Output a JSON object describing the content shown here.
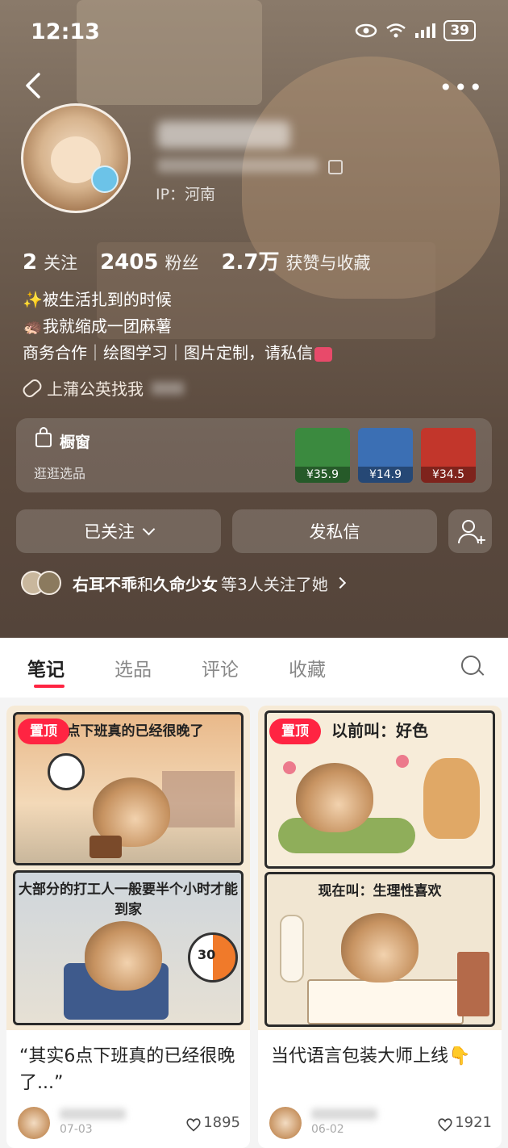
{
  "status_bar": {
    "time": "12:13",
    "battery": "39"
  },
  "profile": {
    "ip_location": "IP：河南",
    "stats": [
      {
        "value": "2",
        "label": "关注"
      },
      {
        "value": "2405",
        "label": "粉丝"
      },
      {
        "value": "2.7万",
        "label": "获赞与收藏"
      }
    ],
    "bio_lines": [
      "✨被生活扎到的时候",
      "🦔我就缩成一团麻薯",
      "商务合作｜绘图学习｜图片定制，请私信"
    ],
    "link_text": "上蒲公英找我"
  },
  "shop": {
    "title": "橱窗",
    "subtitle": "逛逛选品",
    "products": [
      {
        "price": "¥35.9",
        "color": "#3b8a3f"
      },
      {
        "price": "¥14.9",
        "color": "#3b6fb4"
      },
      {
        "price": "¥34.5",
        "color": "#c2362b"
      }
    ]
  },
  "actions": {
    "follow_label": "已关注",
    "message_label": "发私信"
  },
  "mutual": {
    "name1": "右耳不乖",
    "joiner": "和",
    "name2": "久命少女",
    "suffix": "等3人关注了她"
  },
  "tabs": [
    {
      "label": "笔记",
      "active": true
    },
    {
      "label": "选品",
      "active": false
    },
    {
      "label": "评论",
      "active": false
    },
    {
      "label": "收藏",
      "active": false
    }
  ],
  "notes": [
    {
      "pinned_label": "置顶",
      "panel1_caption": "六点下班真的已经很晚了",
      "panel2_caption": "大部分的打工人一般要半个小时才能到家",
      "clock_number": "30",
      "title": "“其实6点下班真的已经很晚了...”",
      "date": "07-03",
      "likes": "1895"
    },
    {
      "pinned_label": "置顶",
      "panel1_caption": "以前叫：好色",
      "panel2_caption": "现在叫：生理性喜欢",
      "title": "当代语言包装大师上线👇",
      "date": "06-02",
      "likes": "1921"
    }
  ],
  "colors": {
    "accent": "#ff2442",
    "header_bg": "#5b4a3e"
  }
}
